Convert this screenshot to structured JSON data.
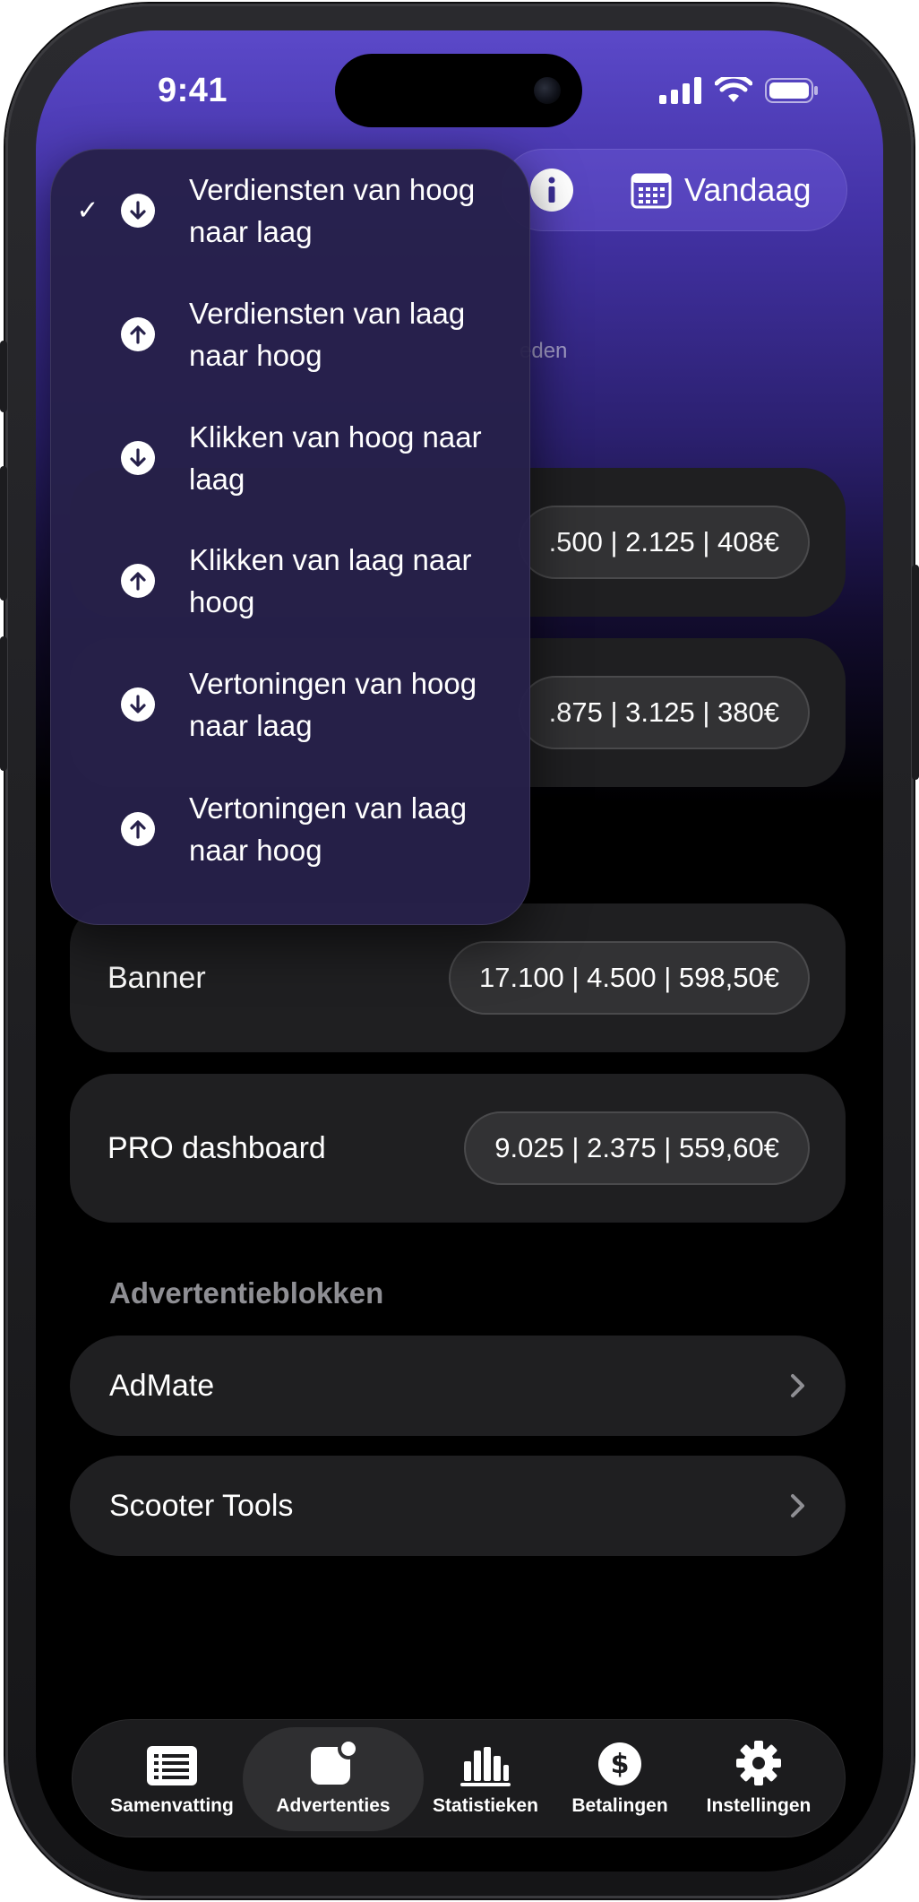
{
  "status_bar": {
    "time": "9:41"
  },
  "toolbar": {
    "date_label": "Vandaag"
  },
  "page": {
    "subtitle_fragment": "eden"
  },
  "cards": [
    {
      "stats": ".500 | 2.125 | 408€"
    },
    {
      "stats": ".875 | 3.125 | 380€"
    },
    {
      "label": "Banner",
      "stats": "17.100 | 4.500 | 598,50€"
    },
    {
      "label": "PRO dashboard",
      "stats": "9.025 | 2.375 | 559,60€"
    }
  ],
  "ad_blocks": {
    "header": "Advertentieblokken",
    "items": [
      {
        "label": "AdMate"
      },
      {
        "label": "Scooter Tools"
      }
    ]
  },
  "sort_menu": {
    "items": [
      {
        "label": "Verdiensten van hoog naar laag",
        "direction": "down",
        "selected": true,
        "check": "✓"
      },
      {
        "label": "Verdiensten van laag naar hoog",
        "direction": "up",
        "selected": false
      },
      {
        "label": "Klikken van hoog naar laag",
        "direction": "down",
        "selected": false
      },
      {
        "label": "Klikken van laag naar hoog",
        "direction": "up",
        "selected": false
      },
      {
        "label": "Vertoningen van hoog naar laag",
        "direction": "down",
        "selected": false
      },
      {
        "label": "Vertoningen van laag naar hoog",
        "direction": "up",
        "selected": false
      }
    ]
  },
  "tabbar": {
    "active": "Advertenties",
    "tabs": [
      {
        "label": "Samenvatting",
        "icon": "list-icon"
      },
      {
        "label": "Advertenties",
        "icon": "ad-badge-icon"
      },
      {
        "label": "Statistieken",
        "icon": "bar-chart-icon"
      },
      {
        "label": "Betalingen",
        "icon": "dollar-icon"
      },
      {
        "label": "Instellingen",
        "icon": "gear-icon"
      }
    ]
  },
  "colors": {
    "gradient_top": "#5b49c9",
    "card_bg": "#1f1f21",
    "menu_bg": "#26204a",
    "section_header": "#8e8e93"
  }
}
